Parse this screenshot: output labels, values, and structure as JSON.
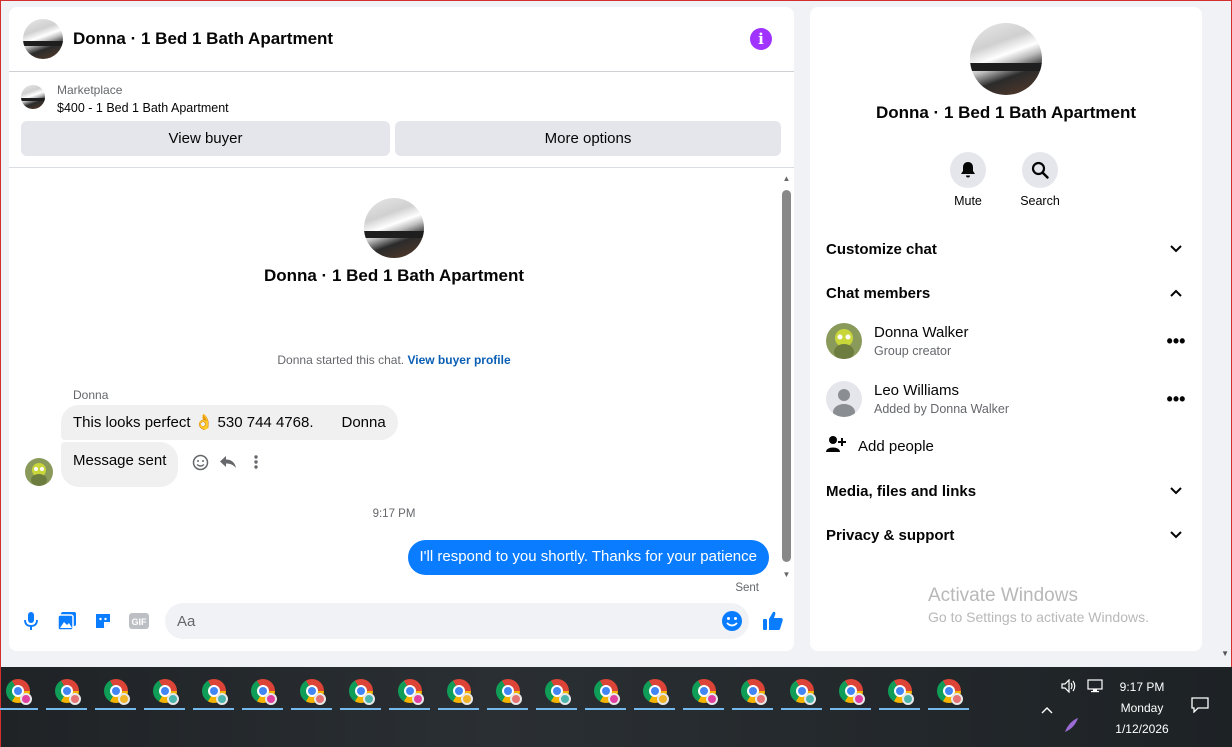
{
  "chat": {
    "header_title": "Donna · 1 Bed 1 Bath Apartment",
    "info_icon": "i",
    "marketplace_label": "Marketplace",
    "listing_title": "$400 - 1 Bed 1 Bath Apartment",
    "view_buyer_label": "View buyer",
    "more_options_label": "More options",
    "intro_title": "Donna · 1 Bed 1 Bath Apartment",
    "system_text": "Donna started this chat.",
    "system_link": "View buyer profile",
    "sender_name": "Donna",
    "messages": [
      {
        "text_main": "This looks perfect 👌 530 744 4768.",
        "text_tail": "Donna",
        "direction": "incoming"
      },
      {
        "text": "Message sent",
        "direction": "incoming"
      },
      {
        "text": "I'll respond to you shortly. Thanks for your patience",
        "direction": "outgoing"
      }
    ],
    "timestamp": "9:17 PM",
    "sent_status": "Sent",
    "composer_placeholder": "Aa",
    "gif_label": "GIF",
    "accent_color": "#0a7cff"
  },
  "info": {
    "title": "Donna · 1 Bed 1 Bath Apartment",
    "mute_label": "Mute",
    "search_label": "Search",
    "sections": {
      "customize": "Customize chat",
      "members": "Chat members",
      "media": "Media, files and links",
      "privacy": "Privacy & support"
    },
    "members": [
      {
        "name": "Donna Walker",
        "subtitle": "Group creator"
      },
      {
        "name": "Leo Williams",
        "subtitle": "Added by Donna Walker"
      }
    ],
    "more_glyph": "•••",
    "add_people_label": "Add people",
    "watermark_title": "Activate Windows",
    "watermark_sub": "Go to Settings to activate Windows."
  },
  "taskbar": {
    "app_count": 20,
    "app_icon": "chrome-icon",
    "time": "9:17 PM",
    "day": "Monday",
    "date": "1/12/2026"
  }
}
